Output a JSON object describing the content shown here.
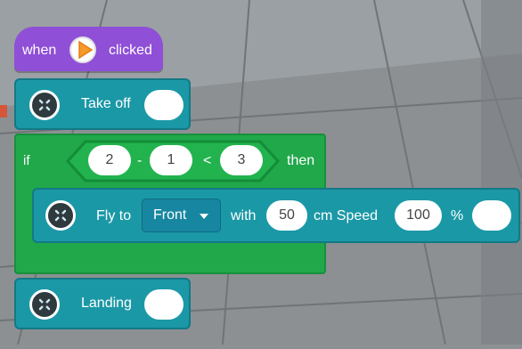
{
  "hat": {
    "when": "when",
    "clicked": "clicked"
  },
  "takeoff": {
    "label": "Take off"
  },
  "if_block": {
    "if_label": "if",
    "then_label": "then",
    "left_value": "2",
    "operator_minus": "-",
    "right_value": "1",
    "compare_op": "<",
    "compare_value": "3"
  },
  "fly": {
    "label": "Fly to",
    "direction": "Front",
    "with_label": "with",
    "distance": "50",
    "distance_unit": "cm Speed",
    "speed": "100",
    "speed_unit": "%"
  },
  "landing": {
    "label": "Landing"
  },
  "colors": {
    "event": "#8f4fd6",
    "drone": "#1b98a6",
    "control": "#20a84a",
    "play_icon": "#f39a2a"
  },
  "icons": {
    "hat_icon": "play-icon",
    "block_icon": "drone-icon",
    "dropdown_icon": "caret-down-icon"
  }
}
